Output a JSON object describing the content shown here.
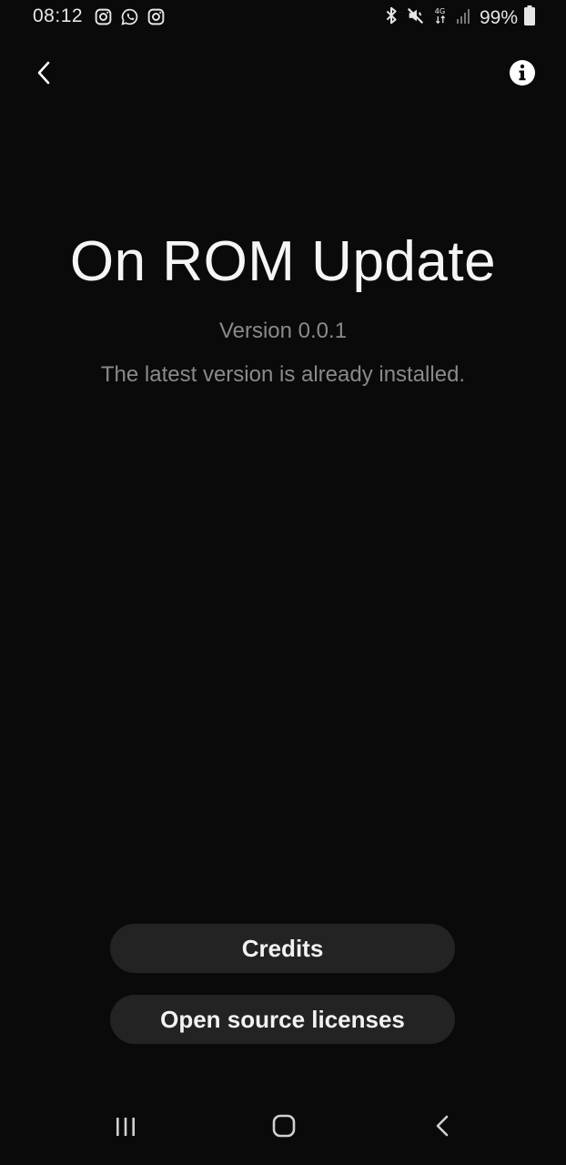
{
  "status_bar": {
    "time": "08:12",
    "battery": "99%",
    "network": "4G"
  },
  "app_bar": {
    "back_icon": "chevron-left-icon",
    "info_icon": "info-icon"
  },
  "main": {
    "title": "On ROM Update",
    "version": "Version 0.0.1",
    "status": "The latest version is already installed."
  },
  "buttons": {
    "credits": "Credits",
    "licenses": "Open source licenses"
  },
  "colors": {
    "background": "#0a0a0a",
    "button_bg": "#232323",
    "muted_text": "#8a8a8a"
  }
}
